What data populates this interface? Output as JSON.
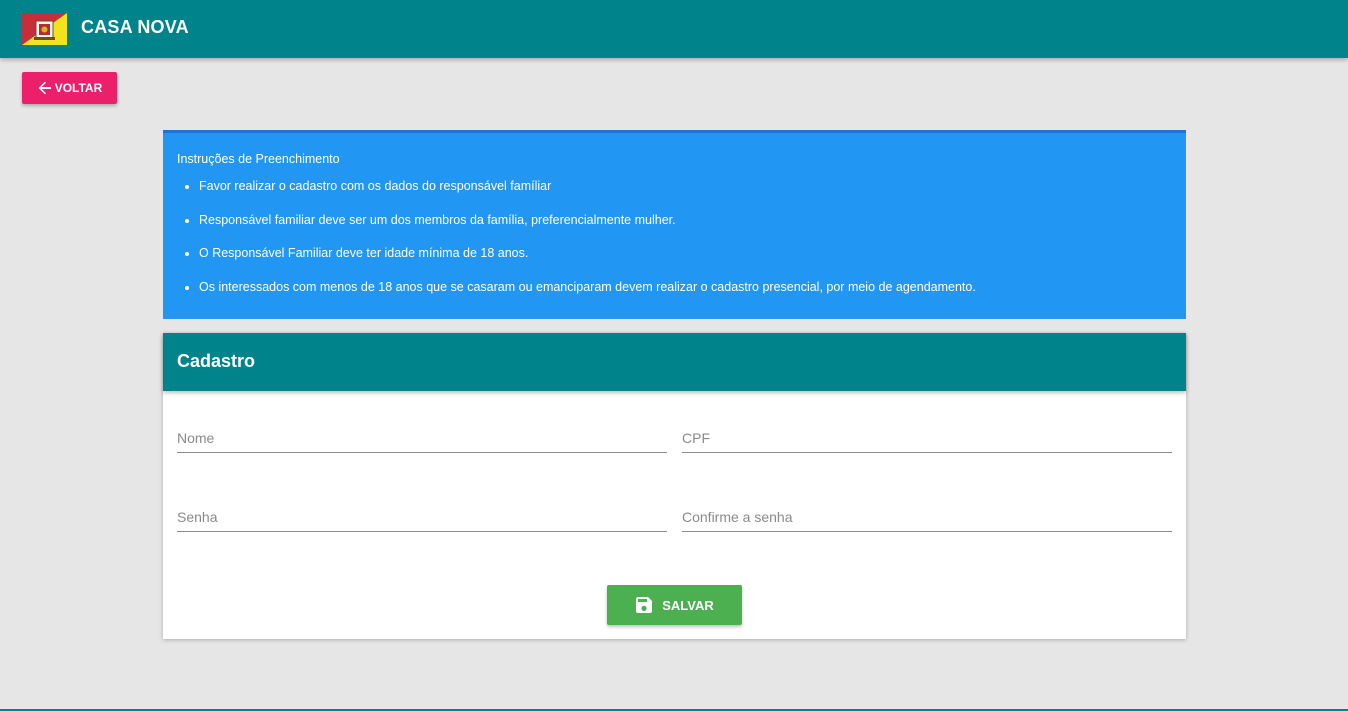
{
  "header": {
    "brand": "CASA NOVA",
    "logo_icon": "city-flag-icon",
    "color": "#00838a"
  },
  "back_button": {
    "label": "VOLTAR",
    "icon": "arrow-left-icon",
    "color": "#ec1f6b"
  },
  "instructions": {
    "title": "Instruções de Preenchimento",
    "color": "#2196f3",
    "items": [
      "Favor realizar o cadastro com os dados do responsável famíliar",
      "Responsável familiar deve ser um dos membros da família, preferencialmente mulher.",
      "O Responsável Familiar deve ter idade mínima de 18 anos.",
      "Os interessados com menos de 18 anos que se casaram ou emanciparam devem realizar o cadastro presencial, por meio de agendamento."
    ]
  },
  "form": {
    "title": "Cadastro",
    "fields": {
      "nome": {
        "placeholder": "Nome",
        "value": ""
      },
      "cpf": {
        "placeholder": "CPF",
        "value": ""
      },
      "senha": {
        "placeholder": "Senha",
        "value": ""
      },
      "confirme": {
        "placeholder": "Confirme a senha",
        "value": ""
      }
    },
    "save_button": {
      "label": "SALVAR",
      "icon": "floppy-disk-icon",
      "color": "#4caf50"
    }
  }
}
